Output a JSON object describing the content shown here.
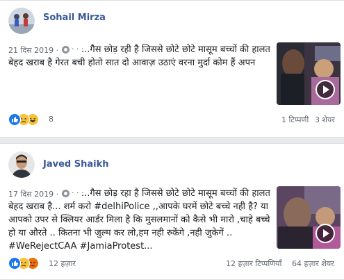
{
  "posts": [
    {
      "author": "Sohail Mirza",
      "date": "21 दिस 2019 · ",
      "options": "· · ·",
      "text": "...गैस छोड़ रही है जिससे छोटे छोटे मासूम बच्चों की हालत बेहद खराब है गेरत बची होतो सात दो आवाज़ उठाएं वरना मुर्दा कोम हैं अपन",
      "reaction_count": "8",
      "comments": "1 टिप्पणी",
      "shares": "3 शेयर",
      "reactions": [
        "like-icon",
        "sad-icon",
        "haha-icon"
      ]
    },
    {
      "author": "Javed Shaikh",
      "date": "17 दिस 2019 · ",
      "options": "· · ·",
      "text": "...गैस छोड़ रहा है जिससे छोटे छोटे मासूम बच्चों की हालत बेहद खराब है... शर्म करो #delhiPolice ,,आपके घरमें छोटे बच्चे नही है? या आपको उपर से क्लियर आर्डर मिला है कि मुसलमानों को कैसे भी मारो ,चाहे बच्चे हो या औरते .. कितना भी जुल्म कर लो,हम नही रुकेंगे ,नही जुकेगें .. #WeRejectCAA #JamiaProtest...",
      "reaction_count": "12 हज़ार",
      "comments": "12 हज़ार टिप्पणियाँ",
      "shares": "64 हज़ार शेयर",
      "reactions": [
        "like-icon",
        "sad-icon",
        "angry-icon"
      ]
    }
  ],
  "colors": {
    "name": "#385898",
    "like": "#1877f2",
    "emoji": "#f7c23b",
    "angry": "#e9710f",
    "background": "#e9ebee"
  }
}
